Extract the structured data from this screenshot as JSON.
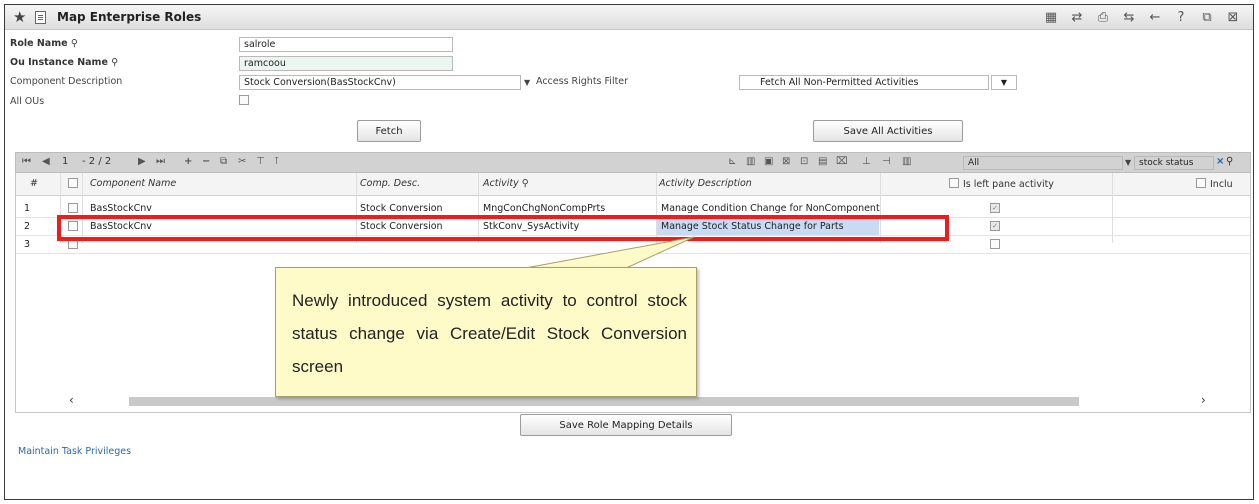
{
  "window": {
    "title": "Map Enterprise Roles",
    "toolbar_icons": [
      "grid-icon",
      "shuffle-icon",
      "print-icon",
      "swap-icon",
      "back-arrow-icon",
      "help-icon",
      "export-icon",
      "close-window-icon"
    ]
  },
  "form": {
    "role_name": {
      "label": "Role Name",
      "value": "salrole"
    },
    "ou_instance": {
      "label": "Ou Instance Name",
      "value": "ramcoou"
    },
    "component_description": {
      "label": "Component Description",
      "value": "Stock Conversion(BasStockCnv)"
    },
    "access_rights_filter": {
      "label": "Access Rights Filter",
      "value": "Fetch All Non-Permitted Activities"
    },
    "all_ous": {
      "label": "All OUs",
      "checked": false
    },
    "fetch_label": "Fetch",
    "save_all_label": "Save All Activities"
  },
  "grid_toolbar": {
    "page_current": "1",
    "page_info": "- 2 / 2",
    "filter_scope": "All",
    "search_value": "stock status"
  },
  "grid": {
    "columns": [
      "#",
      "Component Name",
      "Comp. Desc.",
      "Activity",
      "Activity Description",
      "Is left pane activity",
      "Inclu"
    ],
    "rows": [
      {
        "num": "1",
        "component": "BasStockCnv",
        "desc": "Stock Conversion",
        "activity": "MngConChgNonCompPrts",
        "activity_desc": "Manage Condition Change for NonComponent",
        "left_pane": true
      },
      {
        "num": "2",
        "component": "BasStockCnv",
        "desc": "Stock Conversion",
        "activity": "StkConv_SysActivity",
        "activity_desc": "Manage Stock Status Change for Parts",
        "left_pane": true
      },
      {
        "num": "3",
        "component": "",
        "desc": "",
        "activity": "",
        "activity_desc": "",
        "left_pane": false
      }
    ]
  },
  "callout": {
    "text": "Newly introduced system activity to control stock status change via Create/Edit Stock Conversion screen"
  },
  "save_role_label": "Save Role Mapping Details",
  "footer_link": "Maintain Task Privileges",
  "colors": {
    "highlight": "#ee1c1c",
    "callout_bg": "#fffbc9",
    "selected_cell": "#c9dbf2"
  }
}
